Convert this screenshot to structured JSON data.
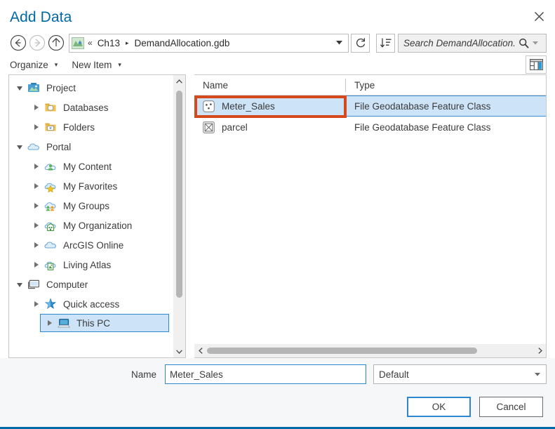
{
  "window": {
    "title": "Add Data",
    "close_icon": "close-icon",
    "accent_color": "#0069a8"
  },
  "nav": {
    "back_icon": "back-arrow-icon",
    "forward_icon": "forward-arrow-icon",
    "up_icon": "up-arrow-icon",
    "refresh_icon": "refresh-icon",
    "sort_icon": "sort-descending-icon",
    "dropdown_icon": "chevron-down-icon",
    "breadcrumb": {
      "source_icon": "geodatabase-icon",
      "overflow": "«",
      "items": [
        "Ch13",
        "DemandAllocation.gdb"
      ],
      "separator": "▸"
    }
  },
  "search": {
    "placeholder": "Search DemandAllocation.",
    "value": "",
    "icon": "search-icon",
    "caret_icon": "chevron-down-icon"
  },
  "toolbar": {
    "organize_label": "Organize",
    "new_item_label": "New Item",
    "caret": "▾",
    "view_icon": "view-layout-icon"
  },
  "tree": {
    "items": [
      {
        "label": "Project",
        "level": 0,
        "state": "expanded",
        "icon": "project-icon",
        "selected": false
      },
      {
        "label": "Databases",
        "level": 1,
        "state": "collapsed",
        "icon": "databases-icon",
        "selected": false
      },
      {
        "label": "Folders",
        "level": 1,
        "state": "collapsed",
        "icon": "folders-icon",
        "selected": false
      },
      {
        "label": "Portal",
        "level": 0,
        "state": "expanded",
        "icon": "portal-cloud-icon",
        "selected": false
      },
      {
        "label": "My Content",
        "level": 1,
        "state": "collapsed",
        "icon": "my-content-icon",
        "selected": false
      },
      {
        "label": "My Favorites",
        "level": 1,
        "state": "collapsed",
        "icon": "my-favorites-icon",
        "selected": false
      },
      {
        "label": "My Groups",
        "level": 1,
        "state": "collapsed",
        "icon": "my-groups-icon",
        "selected": false
      },
      {
        "label": "My Organization",
        "level": 1,
        "state": "collapsed",
        "icon": "my-organization-icon",
        "selected": false
      },
      {
        "label": "ArcGIS Online",
        "level": 1,
        "state": "collapsed",
        "icon": "arcgis-online-icon",
        "selected": false
      },
      {
        "label": "Living Atlas",
        "level": 1,
        "state": "collapsed",
        "icon": "living-atlas-icon",
        "selected": false
      },
      {
        "label": "Computer",
        "level": 0,
        "state": "expanded",
        "icon": "computer-icon",
        "selected": false
      },
      {
        "label": "Quick access",
        "level": 1,
        "state": "collapsed",
        "icon": "quick-access-icon",
        "selected": false
      },
      {
        "label": "This PC",
        "level": 1,
        "state": "collapsed",
        "icon": "this-pc-icon",
        "selected": true
      }
    ],
    "scroll_up_icon": "chevron-up-icon",
    "scroll_down_icon": "chevron-down-icon"
  },
  "file_list": {
    "columns": [
      "Name",
      "Type"
    ],
    "rows": [
      {
        "name": "Meter_Sales",
        "type": "File Geodatabase Feature Class",
        "icon": "point-feature-class-icon",
        "selected": true,
        "annotated": true
      },
      {
        "name": "parcel",
        "type": "File Geodatabase Feature Class",
        "icon": "polygon-feature-class-icon",
        "selected": false,
        "annotated": false
      }
    ],
    "selection_color": "#cde3f7",
    "annotation_color": "#d6491f",
    "scroll_left_icon": "chevron-left-icon",
    "scroll_right_icon": "chevron-right-icon"
  },
  "name_row": {
    "label": "Name",
    "value": "Meter_Sales",
    "type_value": "Default",
    "type_caret_icon": "chevron-down-icon"
  },
  "footer": {
    "ok_label": "OK",
    "cancel_label": "Cancel"
  }
}
